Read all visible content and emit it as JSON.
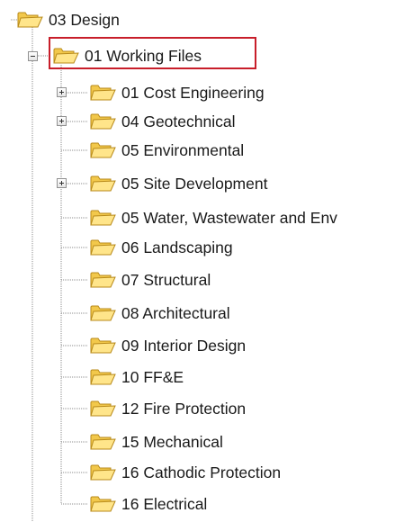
{
  "tree": {
    "root": {
      "label": "03 Design",
      "icon": "open-folder-icon"
    },
    "selected": {
      "label": "01 Working Files",
      "icon": "open-folder-icon",
      "expanded": true,
      "highlight_color": "#c81e2a"
    },
    "children": [
      {
        "label": "01 Cost Engineering",
        "expandable": true
      },
      {
        "label": "04 Geotechnical",
        "expandable": true
      },
      {
        "label": "05 Environmental",
        "expandable": false
      },
      {
        "label": "05 Site Development",
        "expandable": true
      },
      {
        "label": "05 Water, Wastewater and Env",
        "expandable": false
      },
      {
        "label": "06 Landscaping",
        "expandable": false
      },
      {
        "label": "07 Structural",
        "expandable": false
      },
      {
        "label": "08 Architectural",
        "expandable": false
      },
      {
        "label": "09 Interior Design",
        "expandable": false
      },
      {
        "label": "10 FF&E",
        "expandable": false
      },
      {
        "label": "12 Fire Protection",
        "expandable": false
      },
      {
        "label": "15 Mechanical",
        "expandable": false
      },
      {
        "label": "16 Cathodic Protection",
        "expandable": false
      },
      {
        "label": "16 Electrical",
        "expandable": false
      }
    ]
  },
  "colors": {
    "folder_body": "#f2c84b",
    "folder_front": "#ffe58a",
    "folder_outline": "#b88a1a",
    "tree_line": "#8c8c8c"
  }
}
